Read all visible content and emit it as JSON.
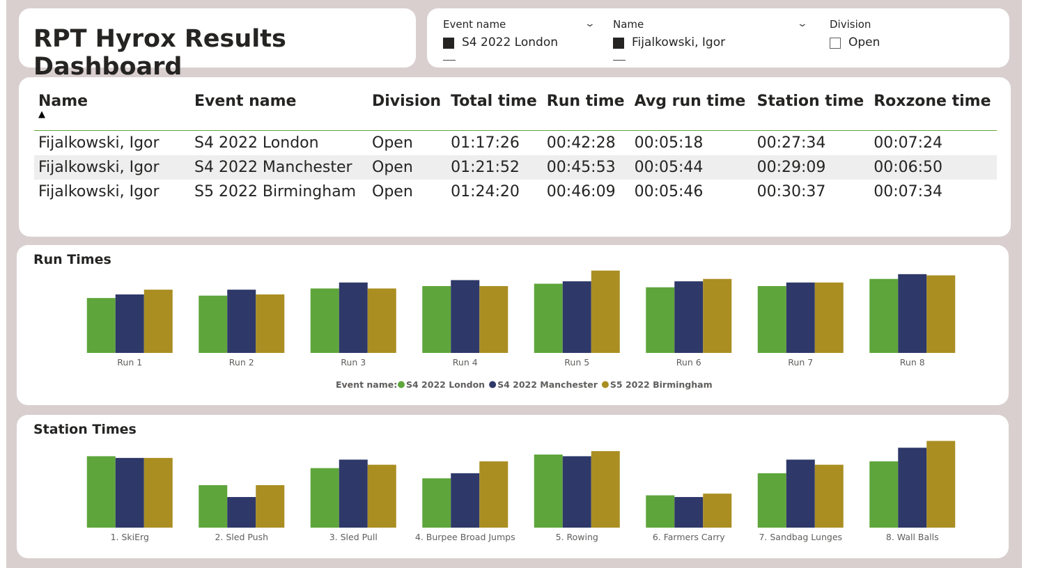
{
  "dashboard": {
    "title": "RPT Hyrox Results Dashboard"
  },
  "slicers": {
    "event": {
      "title": "Event name",
      "value": "S4 2022 London"
    },
    "name": {
      "title": "Name",
      "value": "Fijalkowski, Igor"
    },
    "division": {
      "title": "Division",
      "value": "Open"
    }
  },
  "table": {
    "headers": [
      "Name",
      "Event name",
      "Division",
      "Total time",
      "Run time",
      "Avg run time",
      "Station time",
      "Roxzone time"
    ],
    "rows": [
      [
        "Fijalkowski, Igor",
        "S4 2022 London",
        "Open",
        "01:17:26",
        "00:42:28",
        "00:05:18",
        "00:27:34",
        "00:07:24"
      ],
      [
        "Fijalkowski, Igor",
        "S4 2022 Manchester",
        "Open",
        "01:21:52",
        "00:45:53",
        "00:05:44",
        "00:29:09",
        "00:06:50"
      ],
      [
        "Fijalkowski, Igor",
        "S5 2022 Birmingham",
        "Open",
        "01:24:20",
        "00:46:09",
        "00:05:46",
        "00:30:37",
        "00:07:34"
      ]
    ]
  },
  "colors": {
    "london": "#5ea53b",
    "manchester": "#2e3869",
    "birmingham": "#aa8e22"
  },
  "chart_data": [
    {
      "type": "bar",
      "title": "Run Times",
      "categories": [
        "Run 1",
        "Run 2",
        "Run 3",
        "Run 4",
        "Run 5",
        "Run 6",
        "Run 7",
        "Run 8"
      ],
      "legend_title": "Event name:",
      "legend_position": "bottom-center",
      "series": [
        {
          "name": "S4 2022 London",
          "color": "#5ea53b",
          "values": [
            4.6,
            4.8,
            5.4,
            5.6,
            5.8,
            5.5,
            5.6,
            6.2
          ]
        },
        {
          "name": "S4 2022 Manchester",
          "color": "#2e3869",
          "values": [
            4.9,
            5.3,
            5.9,
            6.1,
            6.0,
            6.0,
            5.9,
            6.6
          ]
        },
        {
          "name": "S5 2022 Birmingham",
          "color": "#aa8e22",
          "values": [
            5.3,
            4.9,
            5.4,
            5.6,
            6.9,
            6.2,
            5.9,
            6.5
          ]
        }
      ],
      "ylim": [
        0,
        7
      ],
      "grid": false
    },
    {
      "type": "bar",
      "title": "Station Times",
      "categories": [
        "1. SkiErg",
        "2. Sled Push",
        "3. Sled Pull",
        "4. Burpee Broad Jumps",
        "5. Rowing",
        "6. Farmers Carry",
        "7. Sandbag Lunges",
        "8. Wall Balls"
      ],
      "series": [
        {
          "name": "S4 2022 London",
          "color": "#5ea53b",
          "values": [
            4.2,
            2.5,
            3.5,
            2.9,
            4.3,
            1.9,
            3.2,
            3.9
          ]
        },
        {
          "name": "S4 2022 Manchester",
          "color": "#2e3869",
          "values": [
            4.1,
            1.8,
            4.0,
            3.2,
            4.2,
            1.8,
            4.0,
            4.7
          ]
        },
        {
          "name": "S5 2022 Birmingham",
          "color": "#aa8e22",
          "values": [
            4.1,
            2.5,
            3.7,
            3.9,
            4.5,
            2.0,
            3.7,
            5.1
          ]
        }
      ],
      "ylim": [
        0,
        5.2
      ],
      "grid": false
    }
  ]
}
